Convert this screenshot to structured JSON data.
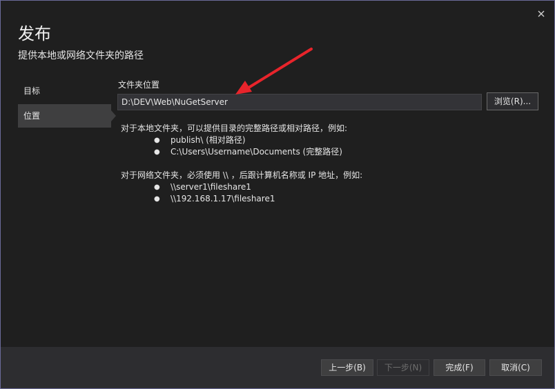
{
  "window": {
    "title": "发布",
    "subtitle": "提供本地或网络文件夹的路径"
  },
  "sidebar": {
    "items": [
      {
        "label": "目标",
        "selected": false
      },
      {
        "label": "位置",
        "selected": true
      }
    ]
  },
  "location": {
    "field_label": "文件夹位置",
    "path_value": "D:\\DEV\\Web\\NuGetServer",
    "browse_label": "浏览(R)..."
  },
  "help": {
    "local_intro": "对于本地文件夹，可以提供目录的完整路径或相对路径，例如:",
    "local_examples": [
      "publish\\ (相对路径)",
      "C:\\Users\\Username\\Documents (完整路径)"
    ],
    "network_intro": "对于网络文件夹，必须使用 \\\\ ，后跟计算机名称或 IP 地址，例如:",
    "network_examples": [
      "\\\\server1\\fileshare1",
      "\\\\192.168.1.17\\fileshare1"
    ],
    "bullet": "●"
  },
  "footer": {
    "back_label": "上一步(B)",
    "next_label": "下一步(N)",
    "finish_label": "完成(F)",
    "cancel_label": "取消(C)"
  },
  "icons": {
    "close": "close-icon",
    "annotation": "red-arrow-annotation"
  },
  "colors": {
    "background": "#1f1f1f",
    "footer": "#2d2d30",
    "selected_nav": "#3f3f40",
    "annotation_red": "#e8242b",
    "window_border": "#6b6b9a"
  }
}
